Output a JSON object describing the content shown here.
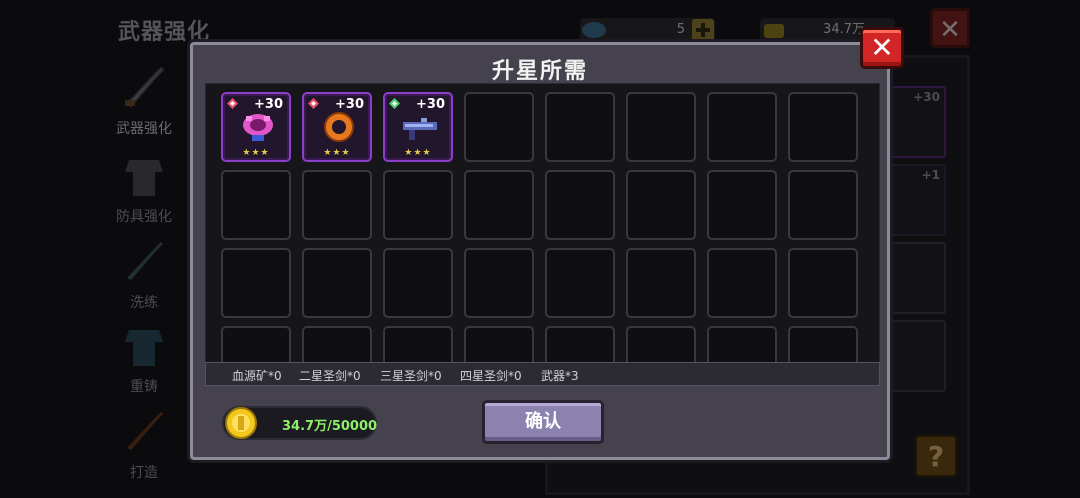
{
  "background": {
    "title": "武器强化",
    "gem_count": "5",
    "coin_count": "34.7万",
    "sidebar": [
      {
        "label": "武器强化"
      },
      {
        "label": "防具强化"
      },
      {
        "label": "洗练"
      },
      {
        "label": "重铸"
      },
      {
        "label": "打造"
      }
    ],
    "right_slot_plus_1": "+30",
    "right_slot_plus_2": "+1",
    "help_label": "?"
  },
  "modal": {
    "title": "升星所需",
    "close_label": "✕",
    "items": [
      {
        "plus": "+30",
        "stars": "★★★",
        "icon": "pink-heart-icon",
        "gem_color": "#e8506a"
      },
      {
        "plus": "+30",
        "stars": "★★★",
        "icon": "orange-ring-icon",
        "gem_color": "#e8506a"
      },
      {
        "plus": "+30",
        "stars": "★★★",
        "icon": "gun-icon",
        "gem_color": "#4ad26a"
      }
    ],
    "requirements": [
      "血源矿*0",
      "二星圣剑*0",
      "三星圣剑*0",
      "四星圣剑*0",
      "武器*3"
    ],
    "coin_text": "34.7万/50000",
    "confirm_label": "确认"
  }
}
